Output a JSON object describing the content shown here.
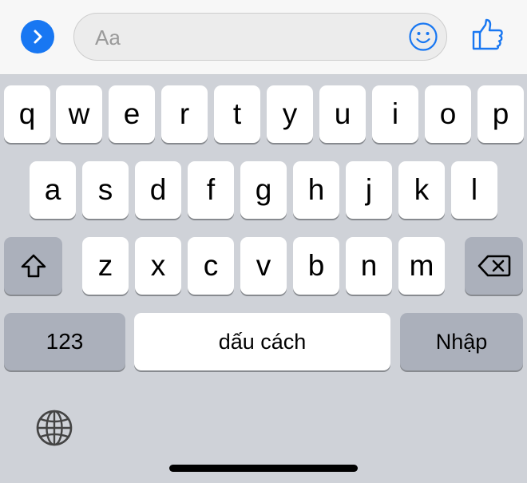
{
  "input": {
    "placeholder": "Aa"
  },
  "icons": {
    "expand": "chevron-right-icon",
    "emoji": "smiley-icon",
    "like": "thumbs-up-icon",
    "shift": "shift-icon",
    "backspace": "backspace-icon",
    "globe": "globe-icon"
  },
  "colors": {
    "accent": "#1877f2",
    "key_light": "#ffffff",
    "key_dark": "#abb0bb",
    "keyboard_bg": "#cfd2d8"
  },
  "keyboard": {
    "row1": [
      "q",
      "w",
      "e",
      "r",
      "t",
      "y",
      "u",
      "i",
      "o",
      "p"
    ],
    "row2": [
      "a",
      "s",
      "d",
      "f",
      "g",
      "h",
      "j",
      "k",
      "l"
    ],
    "row3": [
      "z",
      "x",
      "c",
      "v",
      "b",
      "n",
      "m"
    ],
    "numbers_label": "123",
    "space_label": "dấu cách",
    "enter_label": "Nhập"
  }
}
